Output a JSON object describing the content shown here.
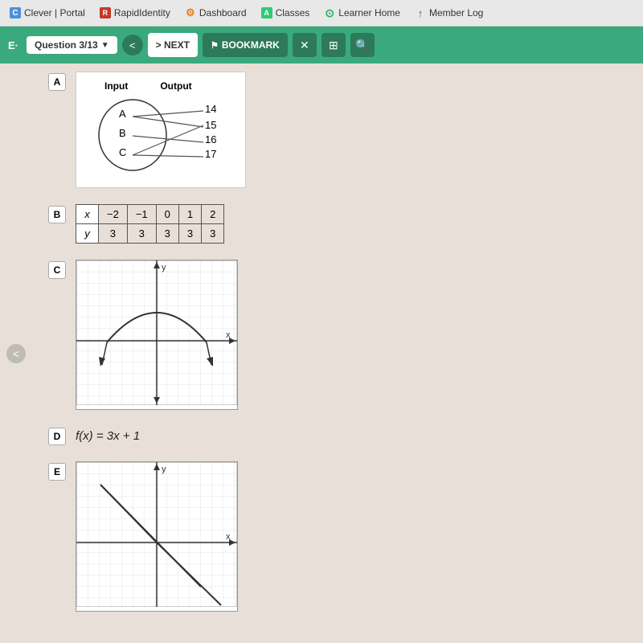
{
  "browser": {
    "tabs": [
      {
        "id": "clever",
        "label": "Clever | Portal",
        "icon": "C",
        "iconClass": "clever"
      },
      {
        "id": "rapid",
        "label": "RapidIdentity",
        "icon": "R",
        "iconClass": "rapid"
      },
      {
        "id": "dashboard",
        "label": "Dashboard",
        "icon": "⚙",
        "iconClass": "dashboard"
      },
      {
        "id": "classes",
        "label": "Classes",
        "icon": "A",
        "iconClass": "classes"
      },
      {
        "id": "learner",
        "label": "Learner Home",
        "icon": "⊙",
        "iconClass": "learner"
      },
      {
        "id": "member",
        "label": "Member Log",
        "icon": "↑",
        "iconClass": "member"
      }
    ]
  },
  "toolbar": {
    "prefix": "E·",
    "question_info": "Question 3/13",
    "nav_back": "<",
    "nav_next": "> NEXT",
    "bookmark_label": "BOOKMARK",
    "close_icon": "✕",
    "grid_icon": "⊞",
    "search_icon": "🔍"
  },
  "content": {
    "left_arrow": "<",
    "options": [
      {
        "id": "A",
        "type": "mapping",
        "inputs": [
          "A",
          "B",
          "C"
        ],
        "outputs": [
          "14",
          "15",
          "16",
          "17"
        ],
        "header_input": "Input",
        "header_output": "Output"
      },
      {
        "id": "B",
        "type": "table",
        "headers": [
          "x",
          "-2",
          "-1",
          "0",
          "1",
          "2"
        ],
        "values": [
          "y",
          "3",
          "3",
          "3",
          "3",
          "3"
        ]
      },
      {
        "id": "C",
        "type": "graph_parabola",
        "description": "Parabola opening downward"
      },
      {
        "id": "D",
        "type": "formula",
        "formula": "f(x) = 3x + 1"
      },
      {
        "id": "E",
        "type": "graph_vshape",
        "description": "V-shape / diagonal lines graph"
      }
    ]
  }
}
